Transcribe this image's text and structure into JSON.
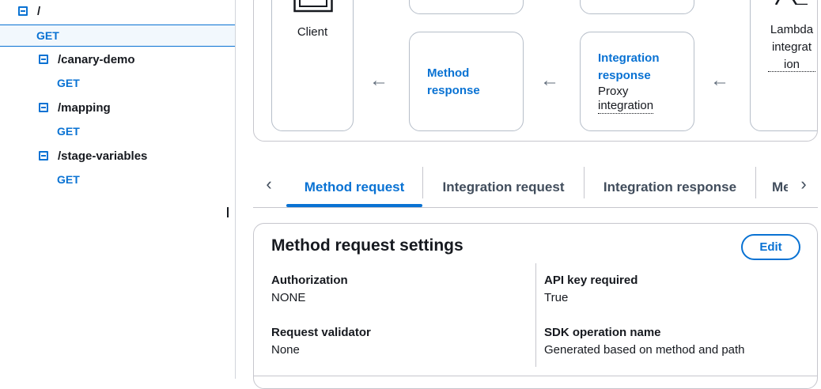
{
  "tree": {
    "root": {
      "label": "/",
      "method": "GET"
    },
    "children": [
      {
        "label": "/canary-demo",
        "method": "GET"
      },
      {
        "label": "/mapping",
        "method": "GET"
      },
      {
        "label": "/stage-variables",
        "method": "GET"
      }
    ]
  },
  "diagram": {
    "client_label": "Client",
    "method_response": {
      "title_line1": "Method",
      "title_line2": "response"
    },
    "integration_response": {
      "title_line1": "Integration",
      "title_line2": "response",
      "sub_line1": "Proxy",
      "sub_line2": "integration"
    },
    "lambda": {
      "line1": "Lambda",
      "line2": "integrat",
      "line3": "ion"
    },
    "arrow_glyph": "←"
  },
  "tabs": {
    "items": [
      "Method request",
      "Integration request",
      "Integration response",
      "Me"
    ],
    "active_index": 0,
    "prev_glyph": "‹",
    "next_glyph": "›"
  },
  "settings": {
    "title": "Method request settings",
    "edit_label": "Edit",
    "fields": {
      "authorization": {
        "label": "Authorization",
        "value": "NONE"
      },
      "request_validator": {
        "label": "Request validator",
        "value": "None"
      },
      "api_key_required": {
        "label": "API key required",
        "value": "True"
      },
      "sdk_operation_name": {
        "label": "SDK operation name",
        "value": "Generated based on method and path"
      }
    }
  },
  "colors": {
    "accent": "#0972d3",
    "border": "#c6c6cd",
    "text": "#16191f",
    "selected_bg": "#f2f8fd"
  }
}
